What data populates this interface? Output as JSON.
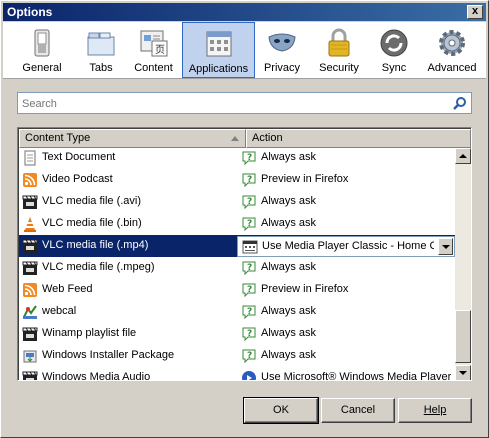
{
  "window": {
    "title": "Options",
    "close_label": "x"
  },
  "toolbar": {
    "items": [
      {
        "label": "General",
        "icon": "switch-icon",
        "selected": false
      },
      {
        "label": "Tabs",
        "icon": "tabs-icon",
        "selected": false
      },
      {
        "label": "Content",
        "icon": "content-icon",
        "selected": false
      },
      {
        "label": "Applications",
        "icon": "applications-icon",
        "selected": true
      },
      {
        "label": "Privacy",
        "icon": "mask-icon",
        "selected": false
      },
      {
        "label": "Security",
        "icon": "padlock-icon",
        "selected": false
      },
      {
        "label": "Sync",
        "icon": "sync-icon",
        "selected": false
      },
      {
        "label": "Advanced",
        "icon": "gear-icon",
        "selected": false
      }
    ]
  },
  "search": {
    "placeholder": "Search",
    "value": ""
  },
  "table": {
    "headers": {
      "content_type": "Content Type",
      "action": "Action"
    },
    "rows": [
      {
        "content_type": "Text Document",
        "type_icon": "document-icon",
        "action": "Always ask",
        "action_icon": "ask-icon"
      },
      {
        "content_type": "Video Podcast",
        "type_icon": "feed-icon",
        "action": "Preview in Firefox",
        "action_icon": "ask-icon"
      },
      {
        "content_type": "VLC media file (.avi)",
        "type_icon": "vlc-clapper-icon",
        "action": "Always ask",
        "action_icon": "ask-icon"
      },
      {
        "content_type": "VLC media file (.bin)",
        "type_icon": "vlc-cone-icon",
        "action": "Always ask",
        "action_icon": "ask-icon"
      },
      {
        "content_type": "VLC media file (.mp4)",
        "type_icon": "vlc-clapper-icon",
        "action": "Use Media Player Classic - Home C...",
        "action_icon": "mpc-icon",
        "selected": true
      },
      {
        "content_type": "VLC media file (.mpeg)",
        "type_icon": "vlc-clapper-icon",
        "action": "Always ask",
        "action_icon": "ask-icon"
      },
      {
        "content_type": "Web Feed",
        "type_icon": "feed-icon",
        "action": "Preview in Firefox",
        "action_icon": "ask-icon"
      },
      {
        "content_type": "webcal",
        "type_icon": "webcal-icon",
        "action": "Always ask",
        "action_icon": "ask-icon"
      },
      {
        "content_type": "Winamp playlist file",
        "type_icon": "vlc-clapper-icon",
        "action": "Always ask",
        "action_icon": "ask-icon"
      },
      {
        "content_type": "Windows Installer Package",
        "type_icon": "installer-icon",
        "action": "Always ask",
        "action_icon": "ask-icon"
      },
      {
        "content_type": "Windows Media Audio",
        "type_icon": "vlc-clapper-icon",
        "action": "Use Microsoft® Windows Media Player",
        "action_icon": "wmp-icon"
      }
    ]
  },
  "buttons": {
    "ok": "OK",
    "cancel": "Cancel",
    "help": "Help"
  },
  "colors": {
    "selection": "#0a246a",
    "titlebar": "#0a246a",
    "toolbar_selected": "#c1d2ee"
  }
}
